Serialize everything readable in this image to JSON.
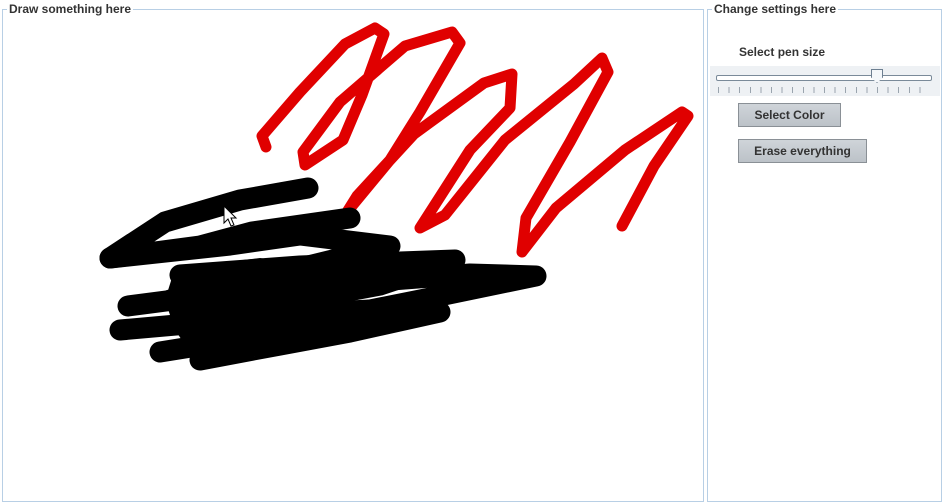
{
  "draw_panel": {
    "title": "Draw something here"
  },
  "settings_panel": {
    "title": "Change settings here",
    "pen_size_label": "Select pen size",
    "pen_size": {
      "value": 75,
      "min": 0,
      "max": 100
    },
    "select_color_label": "Select Color",
    "erase_label": "Erase everything"
  },
  "strokes": {
    "red_color": "#e00000",
    "black_color": "#000000"
  },
  "icons": {
    "cursor": "arrow-cursor-icon",
    "slider_thumb": "slider-thumb-icon"
  }
}
